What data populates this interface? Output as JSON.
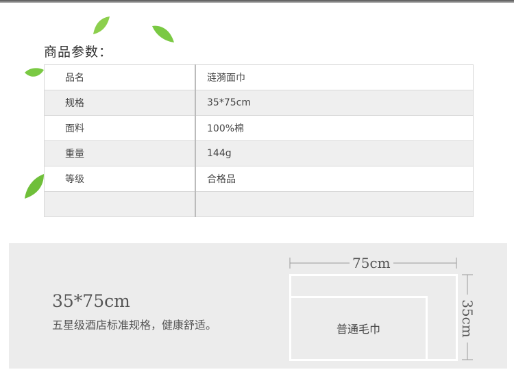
{
  "section_title": "商品参数：",
  "params": [
    {
      "key": "品名",
      "value": "涟漪面巾"
    },
    {
      "key": "规格",
      "value": "35*75cm"
    },
    {
      "key": "面料",
      "value": "100%棉"
    },
    {
      "key": "重量",
      "value": "144g"
    },
    {
      "key": "等级",
      "value": "合格品"
    },
    {
      "key": "",
      "value": ""
    }
  ],
  "size_panel": {
    "size_text": "35*75cm",
    "description": "五星级酒店标准规格，健康舒适。",
    "width_label": "75cm",
    "height_label": "35cm",
    "inner_label": "普通毛巾"
  },
  "colors": {
    "leaf": "#7ac943",
    "panel_bg": "#ececec",
    "row_alt": "#efefef"
  }
}
